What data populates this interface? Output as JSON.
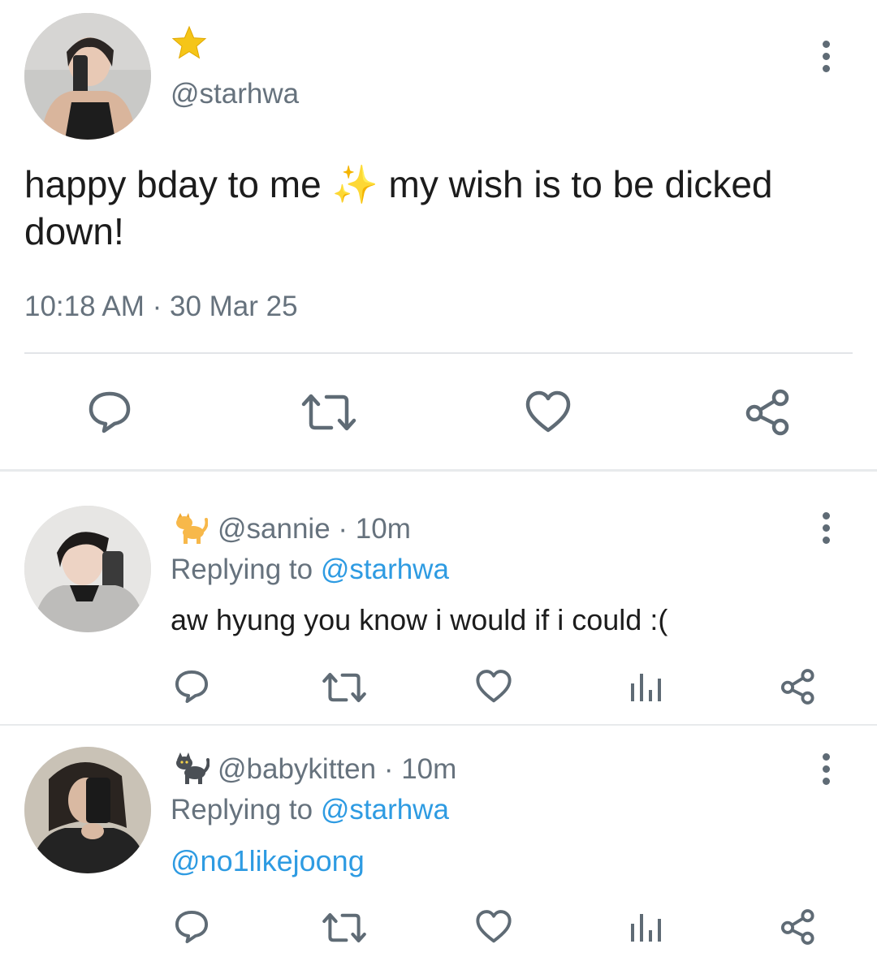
{
  "main_tweet": {
    "name_emoji": "⭐",
    "handle": "@starhwa",
    "text": "happy bday to me ✨ my wish is to be dicked down!",
    "text_line1": "happy bday to me ✨ my wish is to be dicked",
    "text_line2": "down!",
    "timestamp": "10:18 AM · 30 Mar 25",
    "actions": [
      "reply-icon",
      "retweet-icon",
      "like-icon",
      "share-icon"
    ]
  },
  "replies": [
    {
      "name_emoji": "🐈",
      "handle": "@sannie",
      "time": "· 10m",
      "replying_prefix": "Replying to",
      "replying_handle": "@starhwa",
      "text": "aw hyung you know i would if i could :(",
      "actions": [
        "reply-icon",
        "retweet-icon",
        "like-icon",
        "views-icon",
        "share-icon"
      ]
    },
    {
      "name_emoji": "🐈‍⬛",
      "handle": "@babykitten",
      "time": "· 10m",
      "replying_prefix": "Replying to",
      "replying_handle": "@starhwa",
      "text": "@no1likejoong",
      "actions": [
        "reply-icon",
        "retweet-icon",
        "like-icon",
        "views-icon",
        "share-icon"
      ]
    }
  ],
  "colors": {
    "text": "#1c1c1c",
    "muted": "#66727d",
    "link": "#2e9be2",
    "icon": "#5f6b75",
    "star": "#f5c518"
  }
}
